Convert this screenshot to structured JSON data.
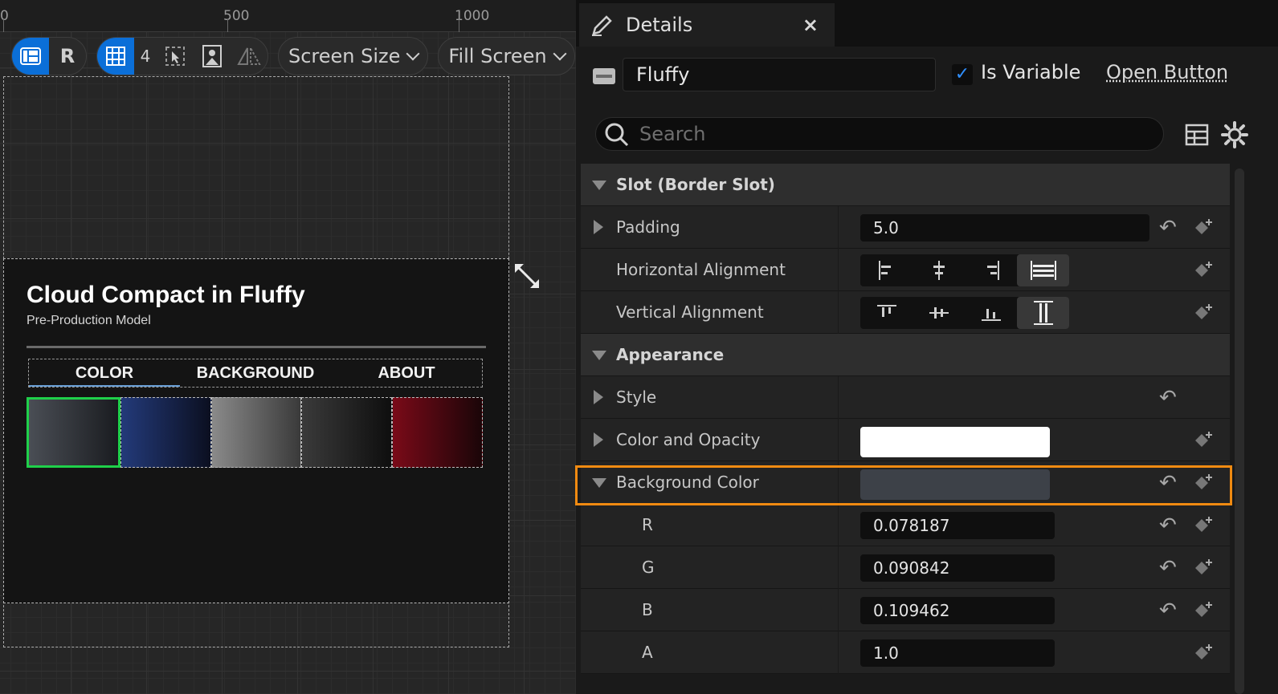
{
  "ruler": {
    "labels": [
      "0",
      "500",
      "1000"
    ]
  },
  "toolbar": {
    "r_label": "R",
    "grid_count": "4",
    "screen_size_label": "Screen Size",
    "fill_screen_label": "Fill Screen"
  },
  "widget": {
    "title": "Cloud Compact in Fluffy",
    "subtitle": "Pre-Production Model",
    "tabs": [
      "COLOR",
      "BACKGROUND",
      "ABOUT"
    ],
    "swatch_colors": [
      [
        "#4a4e55",
        "#1a1c20"
      ],
      [
        "#233a7a",
        "#0b0f20"
      ],
      [
        "#8a8a8a",
        "#3a3a3a"
      ],
      [
        "#3a3a3a",
        "#0e0e0e"
      ],
      [
        "#7a0a18",
        "#1a0508"
      ]
    ]
  },
  "details": {
    "tab_title": "Details",
    "close_glyph": "×",
    "widget_name": "Fluffy",
    "is_variable_label": "Is Variable",
    "is_variable_checked": true,
    "open_button_label": "Open Button",
    "search_placeholder": "Search",
    "sections": {
      "slot": "Slot (Border Slot)",
      "appearance": "Appearance"
    },
    "props": {
      "padding_label": "Padding",
      "padding_value": "5.0",
      "h_align_label": "Horizontal Alignment",
      "v_align_label": "Vertical Alignment",
      "style_label": "Style",
      "color_opacity_label": "Color and Opacity",
      "color_opacity_value": "#ffffff",
      "bg_color_label": "Background Color",
      "bg_color_value": "#3d4148",
      "r_label": "R",
      "r_value": "0.078187",
      "g_label": "G",
      "g_value": "0.090842",
      "b_label": "B",
      "b_value": "0.109462",
      "a_label": "A",
      "a_value": "1.0"
    }
  },
  "colors": {
    "accent_blue": "#0b6fd8",
    "selection_green": "#1fd04a",
    "highlight_orange": "#f08a11"
  }
}
